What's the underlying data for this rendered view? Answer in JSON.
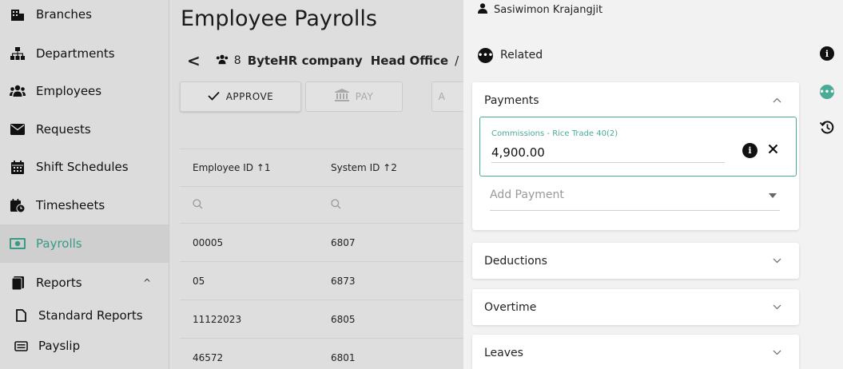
{
  "sidebar": {
    "items": [
      {
        "label": "Branches",
        "icon": "building-icon"
      },
      {
        "label": "Departments",
        "icon": "sitemap-icon"
      },
      {
        "label": "Employees",
        "icon": "users-icon"
      },
      {
        "label": "Requests",
        "icon": "envelope-icon"
      },
      {
        "label": "Shift Schedules",
        "icon": "calendar-icon"
      },
      {
        "label": "Timesheets",
        "icon": "clock-icon"
      },
      {
        "label": "Payrolls",
        "icon": "money-icon",
        "active": true
      },
      {
        "label": "Reports",
        "icon": "file-icon",
        "chevron": "^"
      },
      {
        "label": "Standard Reports",
        "icon": "document-icon"
      },
      {
        "label": "Payslip",
        "icon": "id-card-icon"
      }
    ]
  },
  "main": {
    "title": "Employee Payrolls",
    "breadcrumb": {
      "back": "<",
      "count": "8",
      "company": "ByteHR company",
      "office": "Head Office",
      "more": "/"
    },
    "buttons": {
      "approve": "APPROVE",
      "pay": "PAY",
      "third": "A"
    },
    "table": {
      "headers": [
        "Employee ID ↑1",
        "System ID ↑2"
      ],
      "rows": [
        [
          "00005",
          "6807"
        ],
        [
          "05",
          "6873"
        ],
        [
          "11122023",
          "6805"
        ],
        [
          "46572",
          "6801"
        ]
      ]
    }
  },
  "panel": {
    "user": "Sasiwimon Krajangjit",
    "related_label": "Related",
    "payments": {
      "title": "Payments",
      "field_label": "Commissions - Rice Trade 40(2)",
      "field_value": "4,900.00",
      "add_placeholder": "Add Payment"
    },
    "sections": [
      "Deductions",
      "Overtime",
      "Leaves"
    ]
  },
  "colors": {
    "accent": "#4aab96",
    "active_nav": "#3a9a86"
  }
}
